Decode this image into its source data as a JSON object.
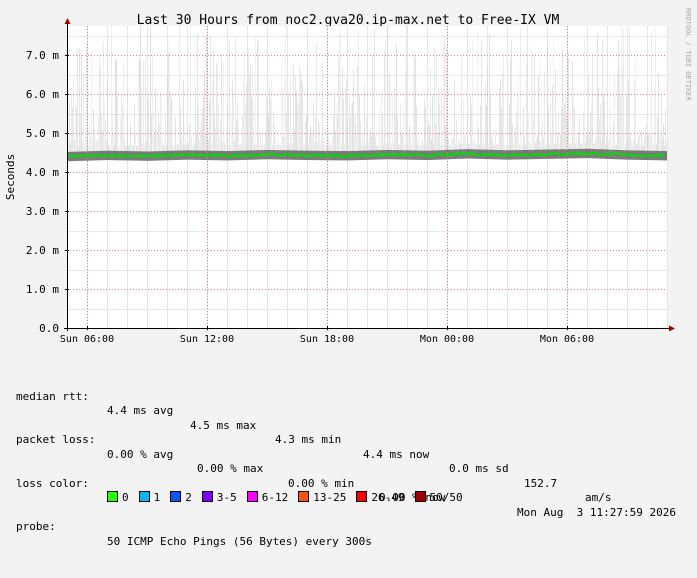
{
  "chart_data": {
    "type": "line",
    "title": "Last 30 Hours from noc2.gva20.ip-max.net to Free-IX_VM",
    "ylabel": "Seconds",
    "xlabel": "",
    "watermark": "RRDTOOL / TOBI OETIKER",
    "ylim": [
      0,
      7.75
    ],
    "y_unit": "ms",
    "y_ticks": [
      {
        "value": 0,
        "label": "0.0"
      },
      {
        "value": 1,
        "label": "1.0 m"
      },
      {
        "value": 2,
        "label": "2.0 m"
      },
      {
        "value": 3,
        "label": "3.0 m"
      },
      {
        "value": 4,
        "label": "4.0 m"
      },
      {
        "value": 5,
        "label": "5.0 m"
      },
      {
        "value": 6,
        "label": "6.0 m"
      },
      {
        "value": 7,
        "label": "7.0 m"
      }
    ],
    "x_range_hours": [
      0,
      30
    ],
    "x_ticks": [
      {
        "hour": 1,
        "label": "Sun 06:00"
      },
      {
        "hour": 7,
        "label": "Sun 12:00"
      },
      {
        "hour": 13,
        "label": "Sun 18:00"
      },
      {
        "hour": 19,
        "label": "Mon 00:00"
      },
      {
        "hour": 25,
        "label": "Mon 06:00"
      }
    ],
    "series": [
      {
        "name": "median rtt",
        "color": "#00dd00",
        "x_hours": [
          0,
          2,
          4,
          6,
          8,
          10,
          12,
          14,
          16,
          18,
          20,
          22,
          24,
          26,
          28,
          30
        ],
        "values": [
          4.4,
          4.43,
          4.41,
          4.44,
          4.42,
          4.45,
          4.43,
          4.42,
          4.45,
          4.43,
          4.47,
          4.44,
          4.46,
          4.48,
          4.44,
          4.42
        ]
      }
    ],
    "colors": {
      "background": "#f3f3f3",
      "plot": "#ffffff",
      "grid_major": "#e08080",
      "grid_minor": "#e6e6e6",
      "smoke": "#d0d0d0",
      "axis": "#000000"
    }
  },
  "legend": {
    "median_rtt": {
      "label": "median rtt:",
      "avg": "4.4 ms avg",
      "max": "4.5 ms max",
      "min": "4.3 ms min",
      "now": "4.4 ms now",
      "sd": "0.0 ms sd",
      "am": "152.7",
      "am_unit": "am/s"
    },
    "packet_loss": {
      "label": "packet loss:",
      "avg": "0.00 % avg",
      "max": "0.00 % max",
      "min": "0.00 % min",
      "now": "0.00 % now"
    },
    "loss_color": {
      "label": "loss color:",
      "items": [
        {
          "label": "0",
          "color": "#26ff00"
        },
        {
          "label": "1",
          "color": "#00b8ff"
        },
        {
          "label": "2",
          "color": "#0059ff"
        },
        {
          "label": "3-5",
          "color": "#7e00ff"
        },
        {
          "label": "6-12",
          "color": "#ff00ff"
        },
        {
          "label": "13-25",
          "color": "#ff5500"
        },
        {
          "label": "26-49",
          "color": "#ff0000"
        },
        {
          "label": "50/50",
          "color": "#a10000"
        }
      ]
    },
    "probe": {
      "label": "probe:",
      "text": "50 ICMP Echo Pings (56 Bytes) every 300s",
      "timestamp": "Mon Aug  3 11:27:59 2026"
    }
  }
}
